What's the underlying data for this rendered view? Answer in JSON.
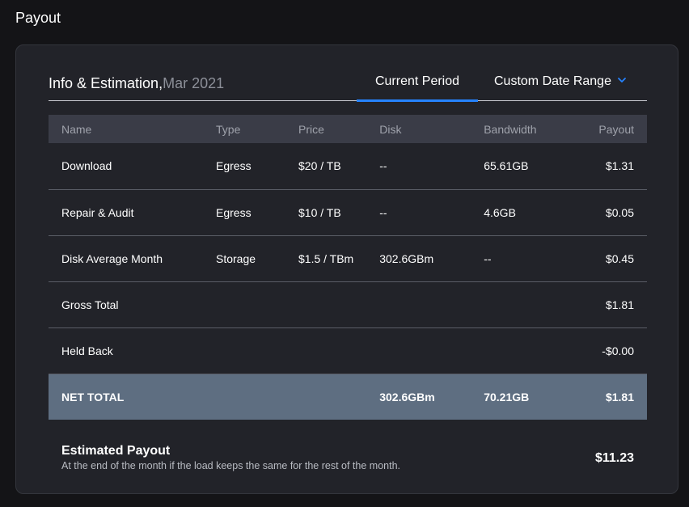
{
  "page": {
    "title": "Payout"
  },
  "header": {
    "heading": "Info & Estimation,",
    "period": "Mar 2021",
    "tabs": [
      {
        "label": "Current Period",
        "active": true
      },
      {
        "label": "Custom Date Range",
        "active": false,
        "icon": "chevron-down-icon"
      }
    ],
    "accent_color": "#2683ff"
  },
  "table": {
    "columns": [
      "Name",
      "Type",
      "Price",
      "Disk",
      "Bandwidth",
      "Payout"
    ],
    "rows": [
      {
        "name": "Download",
        "type": "Egress",
        "price": "$20 / TB",
        "disk": "--",
        "bandwidth": "65.61GB",
        "payout": "$1.31"
      },
      {
        "name": "Repair & Audit",
        "type": "Egress",
        "price": "$10 / TB",
        "disk": "--",
        "bandwidth": "4.6GB",
        "payout": "$0.05"
      },
      {
        "name": "Disk Average Month",
        "type": "Storage",
        "price": "$1.5 / TBm",
        "disk": "302.6GBm",
        "bandwidth": "--",
        "payout": "$0.45"
      }
    ],
    "gross_total": {
      "label": "Gross Total",
      "payout": "$1.81"
    },
    "held_back": {
      "label": "Held Back",
      "payout": "-$0.00"
    },
    "net_total": {
      "label": "NET TOTAL",
      "disk": "302.6GBm",
      "bandwidth": "70.21GB",
      "payout": "$1.81"
    }
  },
  "estimate": {
    "title": "Estimated Payout",
    "description": "At the end of the month if the load keeps the same for the rest of the month.",
    "value": "$11.23"
  }
}
